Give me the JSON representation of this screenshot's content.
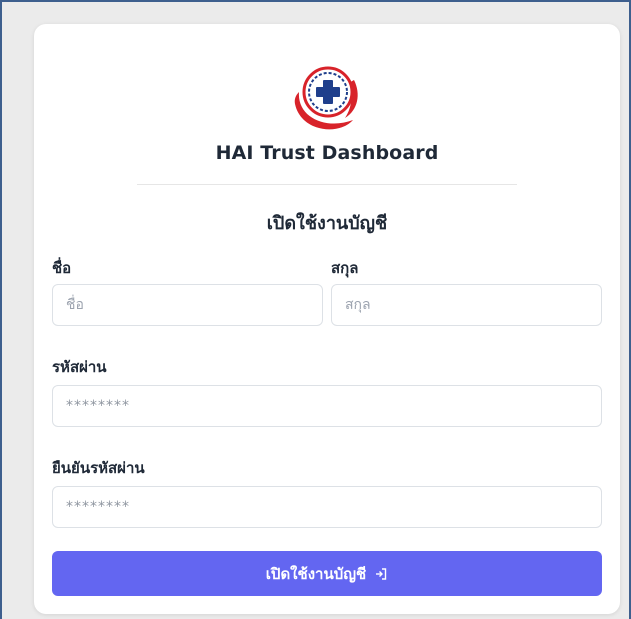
{
  "app": {
    "title": "HAI Trust Dashboard"
  },
  "form": {
    "heading": "เปิดใช้งานบัญชี",
    "first_name": {
      "label": "ชื่อ",
      "placeholder": "ชื่อ"
    },
    "last_name": {
      "label": "สกุล",
      "placeholder": "สกุล"
    },
    "password": {
      "label": "รหัสผ่าน",
      "placeholder": "********"
    },
    "confirm_password": {
      "label": "ยืนยันรหัสผ่าน",
      "placeholder": "********"
    },
    "submit_label": "เปิดใช้งานบัญชี"
  },
  "icons": {
    "logo": "medical-cross-logo-icon",
    "submit": "login-arrow-icon"
  },
  "colors": {
    "primary": "#6366f1",
    "logo_red": "#d8232a",
    "logo_navy": "#1f3f8c",
    "background": "#ebebeb",
    "frame_border": "#3e5f8e"
  }
}
